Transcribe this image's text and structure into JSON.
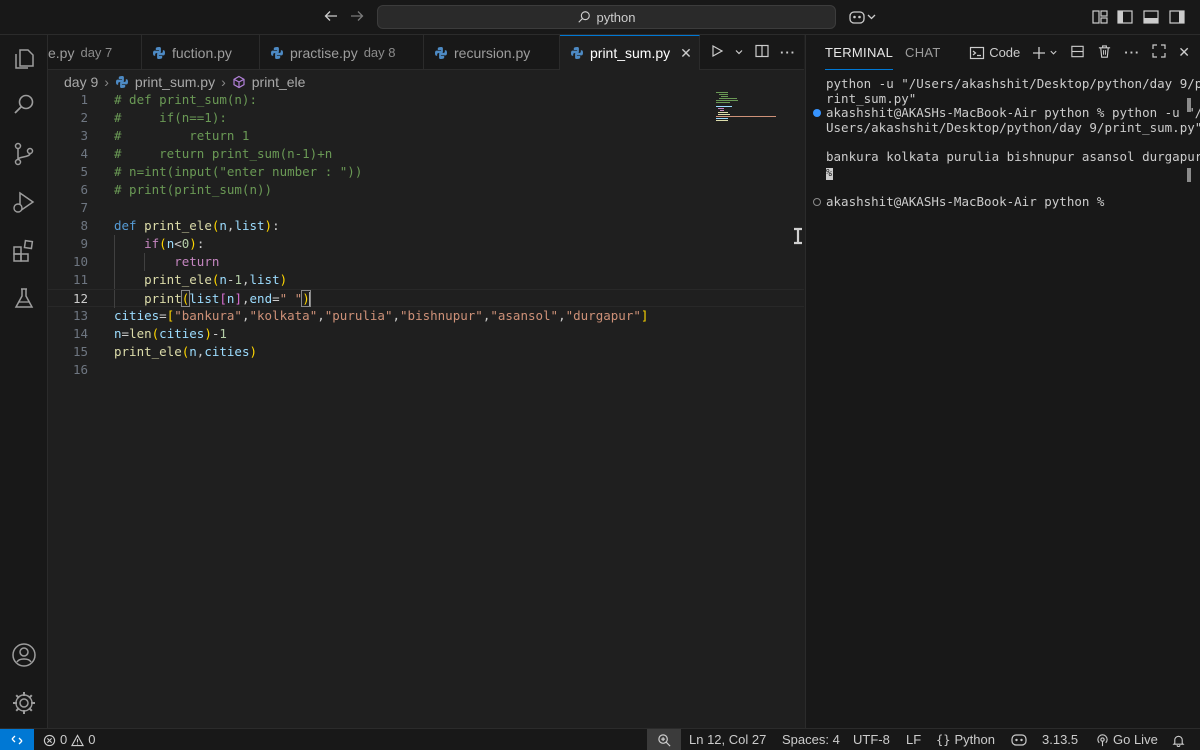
{
  "titlebar": {
    "search_text": "python",
    "icons": [
      "back-arrow-icon",
      "forward-arrow-icon",
      "search-icon",
      "copilot-icon",
      "toggle-primary-sidebar-icon",
      "toggle-panel-icon",
      "toggle-secondary-sidebar-icon",
      "customize-layout-icon"
    ]
  },
  "activitybar": {
    "icons": [
      "explorer-icon",
      "search-icon",
      "source-control-icon",
      "run-debug-icon",
      "extensions-icon",
      "testing-icon",
      "accounts-icon",
      "manage-gear-icon"
    ]
  },
  "tabs": [
    {
      "name": "e.py",
      "desc": "day 7"
    },
    {
      "name": "fuction.py",
      "desc": ""
    },
    {
      "name": "practise.py",
      "desc": "day 8"
    },
    {
      "name": "recursion.py",
      "desc": ""
    },
    {
      "name": "print_sum.py",
      "desc": "",
      "active": true
    }
  ],
  "breadcrumbs": {
    "folder": "day 9",
    "file": "print_sum.py",
    "symbol": "print_ele"
  },
  "code": {
    "line_numbers": [
      "1",
      "2",
      "3",
      "4",
      "5",
      "6",
      "7",
      "8",
      "9",
      "10",
      "11",
      "12",
      "13",
      "14",
      "15",
      "16"
    ],
    "current_line": 12,
    "tokens": {
      "l1": "# def print_sum(n):",
      "l2": "#     if(n==1):",
      "l3": "#         return 1",
      "l4": "#     return print_sum(n-1)+n",
      "l5": "# n=int(input(\"enter number : \"))",
      "l6": "# print(print_sum(n))",
      "def": "def",
      "print_ele": "print_ele",
      "n": "n",
      "list": "list",
      "if": "if",
      "zero": "0",
      "return": "return",
      "print": "print",
      "one": "1",
      "end": "end",
      "space_str": "\" \"",
      "cities": "cities",
      "c1": "\"bankura\"",
      "c2": "\"kolkata\"",
      "c3": "\"purulia\"",
      "c4": "\"bishnupur\"",
      "c5": "\"asansol\"",
      "c6": "\"durgapur\"",
      "len": "len"
    }
  },
  "panel": {
    "tab_terminal": "TERMINAL",
    "tab_chat": "CHAT",
    "terminal_selector": "Code",
    "lines": [
      "python -u \"/Users/akashshit/Desktop/python/day 9/p",
      "rint_sum.py\"",
      "akashshit@AKASHs-MacBook-Air python % python -u \"/",
      "Users/akashshit/Desktop/python/day 9/print_sum.py\"",
      "",
      "bankura kolkata purulia bishnupur asansol durgapur",
      "%",
      "",
      "akashshit@AKASHs-MacBook-Air python %"
    ]
  },
  "statusbar": {
    "errors": "0",
    "warnings": "0",
    "position": "Ln 12, Col 27",
    "spaces": "Spaces: 4",
    "encoding": "UTF-8",
    "eol": "LF",
    "language": "Python",
    "python_version": "3.13.5",
    "golive": "Go Live"
  },
  "colors": {
    "accent": "#0078d4",
    "comment": "#6a9955",
    "keyword": "#569cd6",
    "string": "#ce9178"
  }
}
